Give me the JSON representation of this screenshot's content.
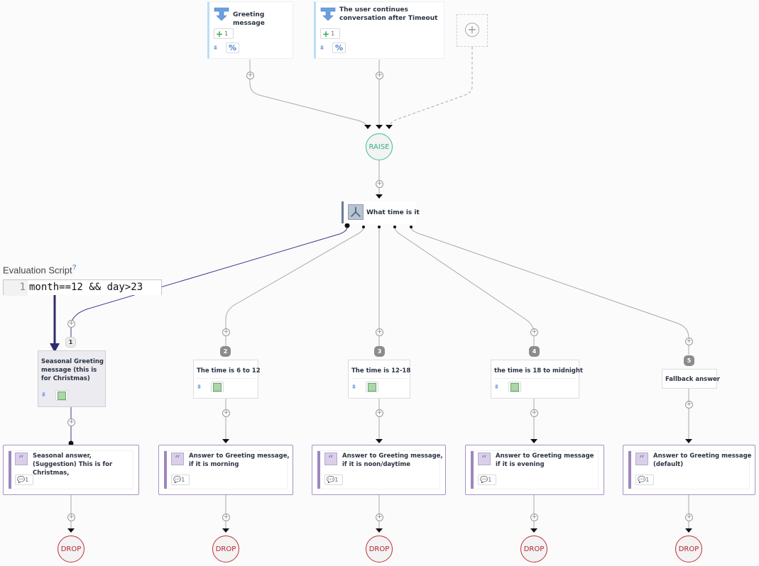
{
  "triggers": [
    {
      "title": "Greeting message",
      "count": "1",
      "icon": "trigger-arrow-icon"
    },
    {
      "title": "The user continues conversation after Timeout",
      "count": "1",
      "icon": "trigger-arrow-icon"
    }
  ],
  "add_trigger": {
    "icon": "plus-circle-icon"
  },
  "raise": {
    "label": "RAISE"
  },
  "router": {
    "title": "What time is it",
    "icon": "router-icon"
  },
  "evaluation_script": {
    "label": "Evaluation Script",
    "help": "?",
    "line_number": "1",
    "code": "month==12 && day>23"
  },
  "branches": [
    {
      "badge": "1",
      "title": "Seasonal Greeting message (this is for Christmas)",
      "selected": true,
      "answer": {
        "title": "Seasonal answer, (Suggestion) This is for Christmas,",
        "count": "1"
      },
      "drop": "DROP"
    },
    {
      "badge": "2",
      "title": "The time is 6 to 12",
      "answer": {
        "title": "Answer to Greeting message, if it is morning",
        "count": "1"
      },
      "drop": "DROP"
    },
    {
      "badge": "3",
      "title": "The time is 12-18",
      "answer": {
        "title": "Answer to Greeting message, if it is noon/daytime",
        "count": "1"
      },
      "drop": "DROP"
    },
    {
      "badge": "4",
      "title": "the time is 18 to midnight",
      "answer": {
        "title": "Answer to Greeting message if it is evening",
        "count": "1"
      },
      "drop": "DROP"
    },
    {
      "badge": "5",
      "title": "Fallback answer",
      "answer": {
        "title": "Answer to Greeting message (default)",
        "count": "1"
      },
      "drop": "DROP"
    }
  ],
  "colors": {
    "raise": "#37c08c",
    "drop": "#c0333a",
    "selected_edge": "#3b3a8c",
    "answer_accent": "#9e86bd",
    "trigger_accent": "#b9dff5"
  }
}
